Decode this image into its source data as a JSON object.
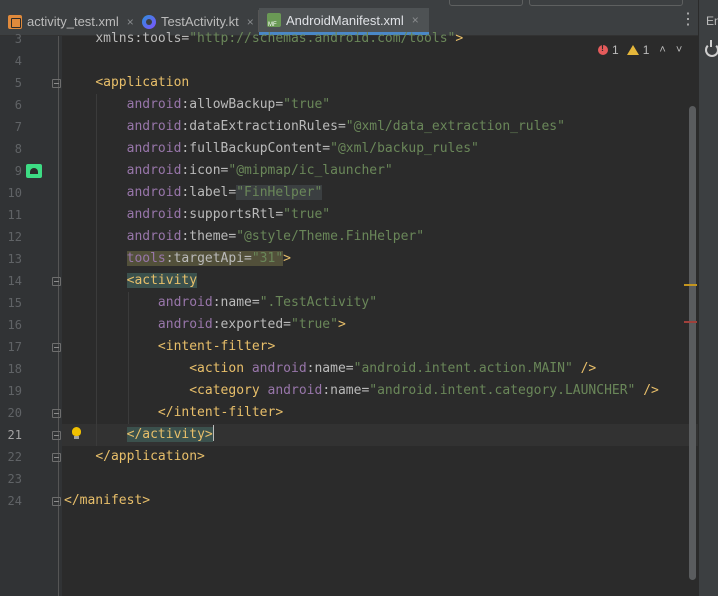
{
  "tabs": [
    {
      "label": "activity_test.xml",
      "icon": "xml-file-icon",
      "active": false
    },
    {
      "label": "TestActivity.kt",
      "icon": "kotlin-file-icon",
      "active": false
    },
    {
      "label": "AndroidManifest.xml",
      "icon": "manifest-file-icon",
      "active": true
    }
  ],
  "tab_close_glyph": "×",
  "menu_glyph": "⋮",
  "side_panel_label": "Em",
  "inspections": {
    "errors": "1",
    "warnings": "1",
    "up_glyph": "˄",
    "down_glyph": "˅"
  },
  "line_numbers": [
    "3",
    "4",
    "5",
    "6",
    "7",
    "8",
    "9",
    "10",
    "11",
    "12",
    "13",
    "14",
    "15",
    "16",
    "17",
    "18",
    "19",
    "20",
    "21",
    "22",
    "23",
    "24"
  ],
  "current_line": "21",
  "code": {
    "l3_attr": "xmlns:tools=",
    "l3_val": "\"http://schemas.android.com/tools\"",
    "l3_end": ">",
    "l5": "<application",
    "l6_ns": "android",
    "l6_attr": ":allowBackup=",
    "l6_val": "\"true\"",
    "l7_ns": "android",
    "l7_attr": ":dataExtractionRules=",
    "l7_val": "\"@xml/data_extraction_rules\"",
    "l8_ns": "android",
    "l8_attr": ":fullBackupContent=",
    "l8_val": "\"@xml/backup_rules\"",
    "l9_ns": "android",
    "l9_attr": ":icon=",
    "l9_val": "\"@mipmap/ic_launcher\"",
    "l10_ns": "android",
    "l10_attr": ":label=",
    "l10_val": "\"FinHelper\"",
    "l11_ns": "android",
    "l11_attr": ":supportsRtl=",
    "l11_val": "\"true\"",
    "l12_ns": "android",
    "l12_attr": ":theme=",
    "l12_val": "\"@style/Theme.FinHelper\"",
    "l13_ns": "tools",
    "l13_attr": ":targetApi=",
    "l13_val": "\"31\"",
    "l13_end": ">",
    "l14": "<activity",
    "l15_ns": "android",
    "l15_attr": ":name=",
    "l15_val": "\".TestActivity\"",
    "l16_ns": "android",
    "l16_attr": ":exported=",
    "l16_val": "\"true\"",
    "l16_end": ">",
    "l17": "<intent-filter>",
    "l18_tag": "<action ",
    "l18_ns": "android",
    "l18_attr": ":name=",
    "l18_val": "\"android.intent.action.MAIN\"",
    "l18_end": " />",
    "l19_tag": "<category ",
    "l19_ns": "android",
    "l19_attr": ":name=",
    "l19_val": "\"android.intent.category.LAUNCHER\"",
    "l19_end": " />",
    "l20": "</intent-filter>",
    "l21": "</activity>",
    "l22": "</application>",
    "l24": "</manifest>"
  }
}
